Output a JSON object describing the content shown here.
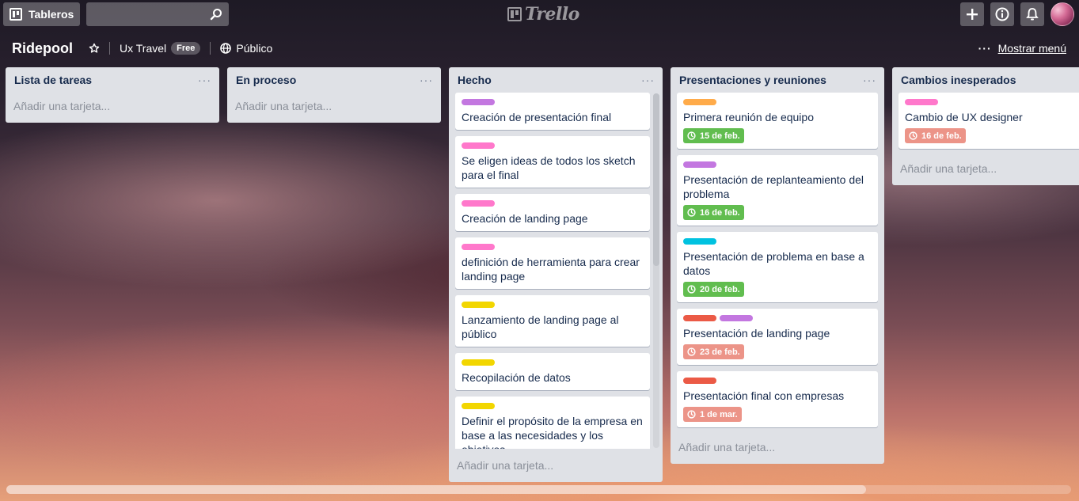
{
  "header": {
    "boards_label": "Tableros",
    "search_value": "",
    "logo_text": "Trello",
    "icons": [
      "boards-icon",
      "search-icon",
      "plus-icon",
      "info-icon",
      "bell-icon",
      "avatar"
    ]
  },
  "board": {
    "title": "Ridepool",
    "team": "Ux Travel",
    "team_badge": "Free",
    "visibility": "Público",
    "menu_dots": "···",
    "show_menu": "Mostrar menú"
  },
  "colors": {
    "purple": "#c377e0",
    "pink": "#ff78cb",
    "yellow": "#f2d600",
    "orange": "#ffab4a",
    "sky": "#00c2e0",
    "red": "#eb5a46",
    "due_green": "#61bd4f",
    "due_red": "#ec9488"
  },
  "lists": [
    {
      "title": "Lista de tareas",
      "menu": "···",
      "add_card": "Añadir una tarjeta...",
      "cards": []
    },
    {
      "title": "En proceso",
      "menu": "···",
      "add_card": "Añadir una tarjeta...",
      "cards": []
    },
    {
      "title": "Hecho",
      "menu": "···",
      "add_card": "Añadir una tarjeta...",
      "cards": [
        {
          "title": "Creación de presentación final",
          "labels": [
            "purple"
          ]
        },
        {
          "title": "Se eligen ideas de todos los sketch para el final",
          "labels": [
            "pink"
          ]
        },
        {
          "title": "Creación de landing page",
          "labels": [
            "pink"
          ]
        },
        {
          "title": "definición de herramienta para crear landing page",
          "labels": [
            "pink"
          ]
        },
        {
          "title": "Lanzamiento de landing page al público",
          "labels": [
            "yellow"
          ]
        },
        {
          "title": "Recopilación de datos",
          "labels": [
            "yellow"
          ]
        },
        {
          "title": "Definir el propósito de la empresa en base a las necesidades y los objetivos",
          "labels": [
            "yellow"
          ]
        }
      ]
    },
    {
      "title": "Presentaciones y reuniones",
      "menu": "···",
      "add_card": "Añadir una tarjeta...",
      "cards": [
        {
          "title": "Primera reunión de equipo",
          "labels": [
            "orange"
          ],
          "due": "15 de feb.",
          "due_status": "green"
        },
        {
          "title": "Presentación de replanteamiento del problema",
          "labels": [
            "purple"
          ],
          "due": "16 de feb.",
          "due_status": "green"
        },
        {
          "title": "Presentación de problema en base a datos",
          "labels": [
            "sky"
          ],
          "due": "20 de feb.",
          "due_status": "green"
        },
        {
          "title": "Presentación de landing page",
          "labels": [
            "red",
            "purple"
          ],
          "due": "23 de feb.",
          "due_status": "red"
        },
        {
          "title": "Presentación final con empresas",
          "labels": [
            "red"
          ],
          "due": "1 de mar.",
          "due_status": "red"
        }
      ]
    },
    {
      "title": "Cambios inesperados",
      "menu": "",
      "add_card": "Añadir una tarjeta...",
      "cards": [
        {
          "title": "Cambio de UX designer",
          "labels": [
            "pink"
          ],
          "due": "16 de feb.",
          "due_status": "red"
        }
      ]
    }
  ]
}
